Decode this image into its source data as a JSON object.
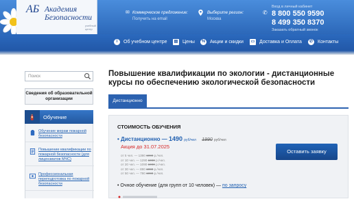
{
  "header": {
    "logo_mark": "АБ",
    "logo_title_line1": "Академия",
    "logo_title_line2": "Безопасности",
    "logo_subtitle": "учебный центр",
    "commercial_label": "Коммерческое предложение:",
    "commercial_value": "Получить на email",
    "region_label": "Выберите регион:",
    "region_value": "Москва",
    "cabinet_link": "Вход в личный кабинет",
    "phone1": "8 800 550 9590",
    "phone2": "8 499 350 8370",
    "callback_link": "Заказать обратный звонок"
  },
  "nav": {
    "items": [
      {
        "label": "Об учебном центре",
        "icon": "info-icon"
      },
      {
        "label": "Цены",
        "icon": "price-icon"
      },
      {
        "label": "Акции и скидки",
        "icon": "discount-icon"
      },
      {
        "label": "Доставка и Оплата",
        "icon": "delivery-icon"
      },
      {
        "label": "Контакты",
        "icon": "contacts-icon"
      }
    ]
  },
  "sidebar": {
    "search_placeholder": "Поиск",
    "info_box": "Сведения об образовательной организации",
    "section_title": "Обучение",
    "items": [
      {
        "label": "Обучение мерам пожарной безопасности"
      },
      {
        "label": "Повышение квалификации по пожарной безопасности (для лицензиатов МЧС)"
      },
      {
        "label": "Профессиональная переподготовка по пожарной безопасности"
      }
    ]
  },
  "main": {
    "title": "Повышение квалификации по экологии - дистанционные курсы по обеспечению экологической безопасности",
    "tab_label": "Дистанционно",
    "price_title": "СТОИМОСТЬ ОБУЧЕНИЯ",
    "remote_label": "Дистанционно —",
    "remote_price": "1490",
    "remote_unit": "руб/чел",
    "remote_old_price": "1990",
    "remote_old_unit": "руб/чел",
    "promo": "Акция до 31.07.2025",
    "tiers": [
      {
        "from": "от 5 чел. — 1390",
        "old": "1990",
        "unit": "р./чел."
      },
      {
        "from": "от 10 чел. — 1290",
        "old": "1990",
        "unit": "р./чел."
      },
      {
        "from": "от 20 чел. — 1090",
        "old": "1990",
        "unit": "р./чел."
      },
      {
        "from": "от 30 чел. — 890",
        "old": "1990",
        "unit": "р./чел."
      },
      {
        "from": "от 50 чел. — 790",
        "old": "1990",
        "unit": "р./чел."
      }
    ],
    "offline_text": "Очное обучение (для групп от 10 человек) —",
    "offline_link": "по запросу",
    "apply_button": "Оставить заявку"
  },
  "colors": {
    "brand_blue": "#2f6fc4",
    "link_blue": "#1f5fb0",
    "promo_red": "#d62828"
  }
}
